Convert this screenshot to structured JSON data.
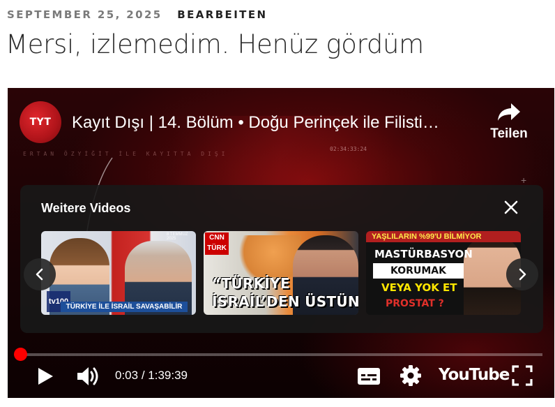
{
  "post": {
    "date": "SEPTEMBER 25, 2025",
    "edit_link": "BEARBEITEN",
    "title": "Mersi, izlemedim. Henüz gördüm"
  },
  "player": {
    "channel_logo_text": "TYT",
    "video_title": "Kayıt Dışı | 14. Bölüm • Doğu Perinçek ile Filisti…",
    "share_label": "Teilen",
    "background_text": "ERTAN ÖZYİĞİT İLE KAYITTA DIŞI",
    "background_clock": "02:34:33:24",
    "more_videos": {
      "heading": "Weitere Videos",
      "videos": [
        {
          "caption": "TÜRKİYE İLE İSRAİL SAVAŞABİLİR",
          "channel": "tv100",
          "date": "8 TEMMUZ 2025"
        },
        {
          "channel": "CNN TÜRK",
          "caption_line1": "“TÜRKİYE",
          "caption_line2": "İSRAİL’DEN ÜSTÜN”"
        },
        {
          "top_banner": "YAŞLILARIN %99'U BİLMİYOR",
          "line1": "MASTÜRBASYON",
          "line2": "KORUMAK",
          "line3": "VEYA YOK ET",
          "line4": "PROSTAT ?"
        }
      ]
    },
    "progress_fraction": 0.0005,
    "time_current": "0:03",
    "time_separator": " / ",
    "time_total": "1:39:39",
    "brand_logo": "YouTube",
    "accent_color": "#ff0000",
    "icons": {
      "share": "share-arrow-icon",
      "close": "close-icon",
      "prev": "chevron-left-icon",
      "next": "chevron-right-icon",
      "play": "play-icon",
      "volume": "volume-icon",
      "subtitles": "subtitles-icon",
      "settings": "gear-icon",
      "fullscreen": "fullscreen-icon"
    }
  }
}
